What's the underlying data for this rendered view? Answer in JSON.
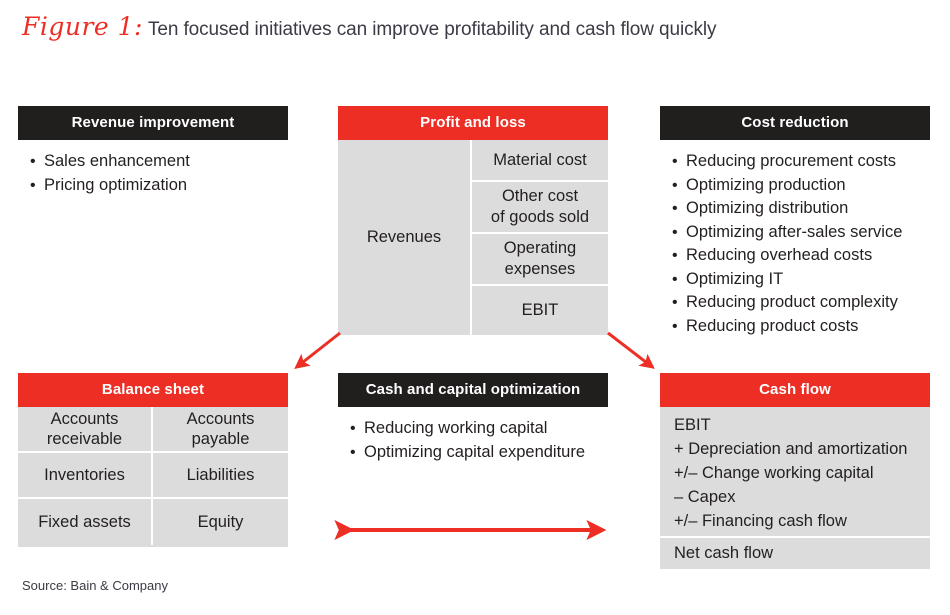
{
  "figure": {
    "label": "Figure 1:",
    "caption": "Ten focused initiatives can improve profitability and cash flow quickly"
  },
  "colors": {
    "accent_red": "#ED2E24",
    "header_dark": "#211E1E",
    "panel_gray": "#DCDCDC",
    "text": "#231f20"
  },
  "panels": {
    "revenue_improvement": {
      "title": "Revenue improvement",
      "header_style": "dark",
      "bullets": [
        "Sales enhancement",
        "Pricing optimization"
      ]
    },
    "profit_and_loss": {
      "title": "Profit and loss",
      "header_style": "red",
      "left_cell": "Revenues",
      "right_cells": [
        "Material cost",
        "Other cost\nof goods sold",
        "Operating\nexpenses",
        "EBIT"
      ]
    },
    "cost_reduction": {
      "title": "Cost reduction",
      "header_style": "dark",
      "bullets": [
        "Reducing procurement costs",
        "Optimizing production",
        "Optimizing distribution",
        "Optimizing after-sales service",
        "Reducing overhead costs",
        "Optimizing IT",
        "Reducing product complexity",
        "Reducing product costs"
      ]
    },
    "balance_sheet": {
      "title": "Balance sheet",
      "header_style": "red",
      "rows": [
        {
          "left": "Accounts\nreceivable",
          "right": "Accounts\npayable"
        },
        {
          "left": "Inventories",
          "right": "Liabilities"
        },
        {
          "left": "Fixed assets",
          "right": "Equity"
        }
      ]
    },
    "cash_and_capital_optimization": {
      "title": "Cash and capital optimization",
      "header_style": "dark",
      "bullets": [
        "Reducing working capital",
        "Optimizing capital expenditure"
      ]
    },
    "cash_flow": {
      "title": "Cash flow",
      "header_style": "red",
      "lines": [
        "EBIT",
        "+ Depreciation and amortization",
        "+/– Change working capital",
        "– Capex",
        "+/– Financing cash flow"
      ],
      "total_line": "Net cash flow"
    }
  },
  "arrows": {
    "left_diagonal": "arrow-pl-to-balance-sheet",
    "right_diagonal": "arrow-pl-to-cash-flow",
    "double_headed": "arrow-double-headed-horizontal"
  },
  "source": "Source: Bain & Company"
}
